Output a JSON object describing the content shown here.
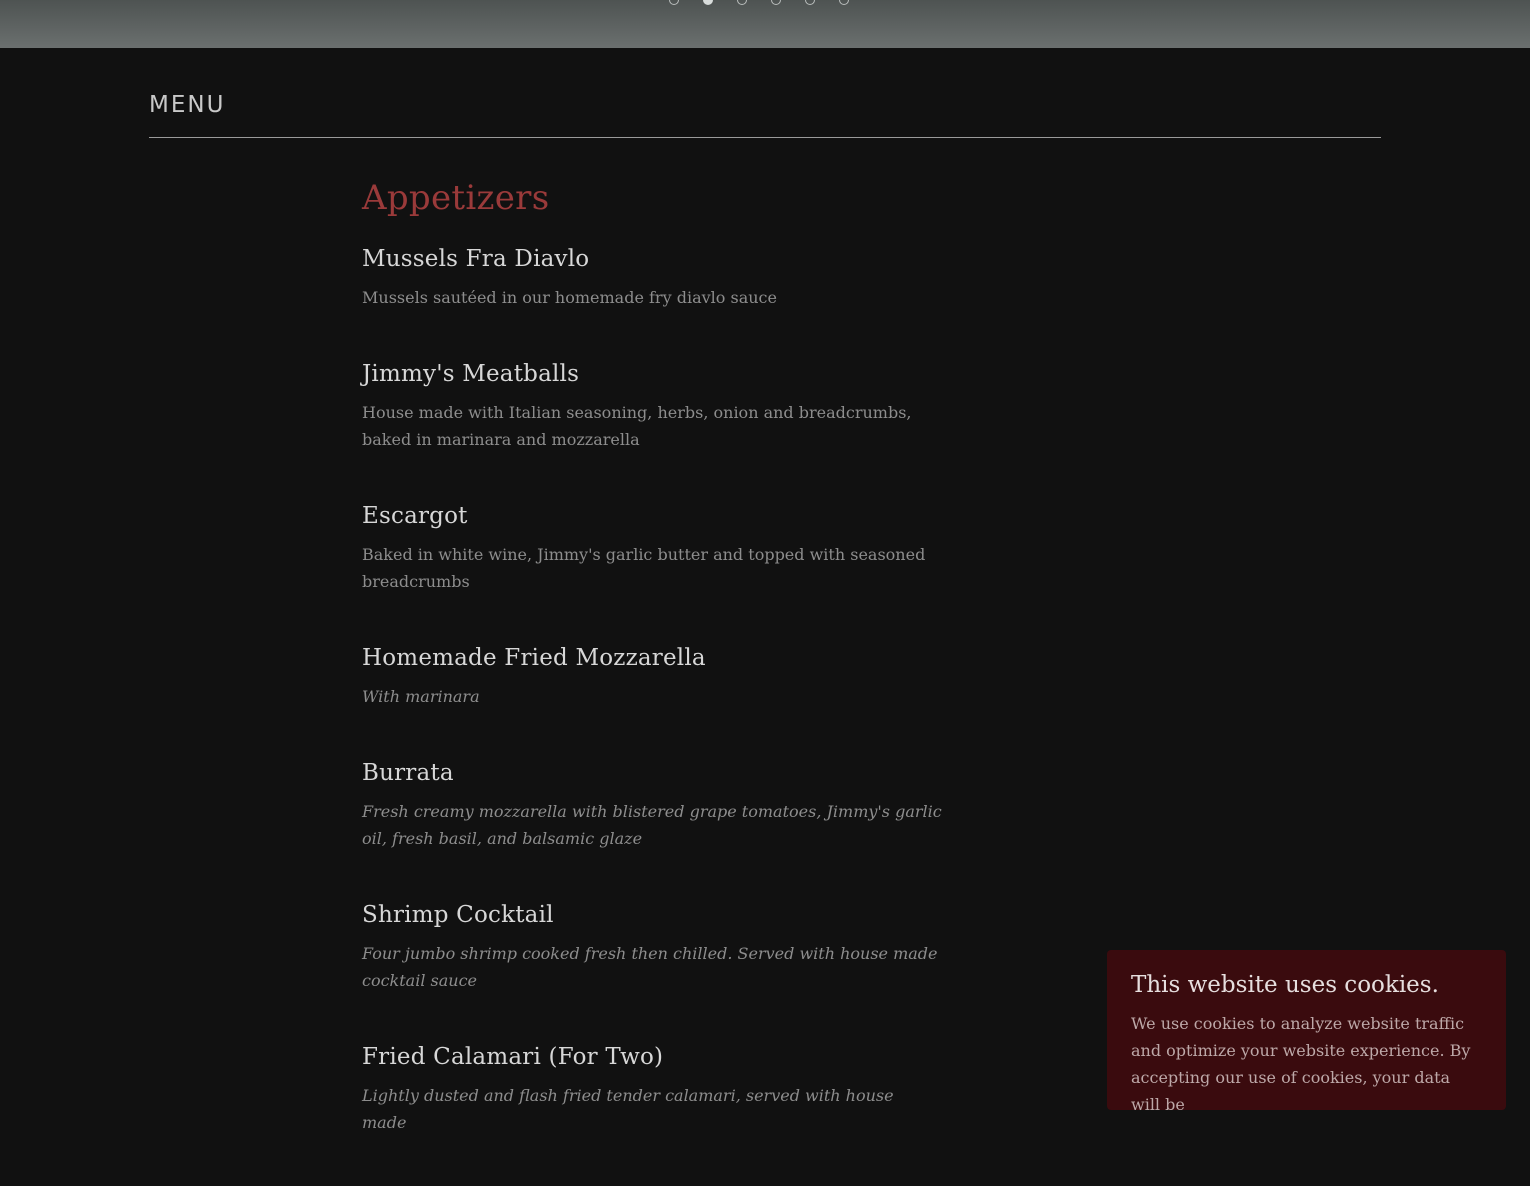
{
  "slider": {
    "dot_count": 6,
    "active_index": 1
  },
  "menu": {
    "heading": "MENU"
  },
  "category": {
    "title": "Appetizers",
    "items": [
      {
        "name": "Mussels Fra Diavlo",
        "description": "Mussels sautéed in our homemade fry diavlo sauce",
        "italic": false
      },
      {
        "name": "Jimmy's Meatballs",
        "description": "House made with Italian seasoning, herbs, onion and breadcrumbs, baked in marinara and mozzarella",
        "italic": false
      },
      {
        "name": "Escargot",
        "description": "Baked in white wine, Jimmy's garlic butter and topped with seasoned breadcrumbs",
        "italic": false
      },
      {
        "name": "Homemade Fried Mozzarella",
        "description": "With marinara",
        "italic": true
      },
      {
        "name": "Burrata",
        "description": "Fresh creamy mozzarella with blistered grape tomatoes, Jimmy's garlic oil, fresh basil, and balsamic glaze",
        "italic": true
      },
      {
        "name": "Shrimp Cocktail",
        "description": "Four jumbo shrimp cooked fresh then chilled. Served with house made cocktail sauce",
        "italic": true
      },
      {
        "name": "Fried Calamari (For Two)",
        "description": "Lightly dusted and flash fried tender calamari, served with house made",
        "italic": true
      }
    ]
  },
  "cookie_banner": {
    "title": "This website uses cookies.",
    "text": "We use cookies to analyze website traffic and optimize your website experience. By accepting our use of cookies, your data will be"
  },
  "colors": {
    "background": "#111111",
    "accent": "#9a3a3a",
    "cookie_background": "#3a0b0e"
  }
}
